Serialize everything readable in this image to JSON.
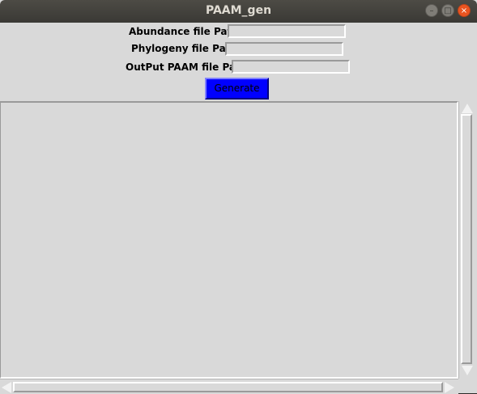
{
  "window": {
    "title": "PAAM_gen",
    "minimize_glyph": "–",
    "maximize_glyph": "□",
    "close_glyph": "×"
  },
  "form": {
    "abundance_label": "Abundance file Path:",
    "abundance_value": "",
    "phylogeny_label": "Phylogeny file Path",
    "phylogeny_value": "",
    "output_label": "OutPut PAAM file Path",
    "output_value": "",
    "generate_label": "Generate"
  },
  "output": {
    "text": ""
  },
  "colors": {
    "generate_bg": "#0000ff",
    "window_bg": "#d9d9d9",
    "close_button": "#e95420"
  },
  "icons": [
    "minimize-icon",
    "maximize-icon",
    "close-icon",
    "scroll-up-icon",
    "scroll-down-icon",
    "scroll-left-icon",
    "scroll-right-icon"
  ]
}
